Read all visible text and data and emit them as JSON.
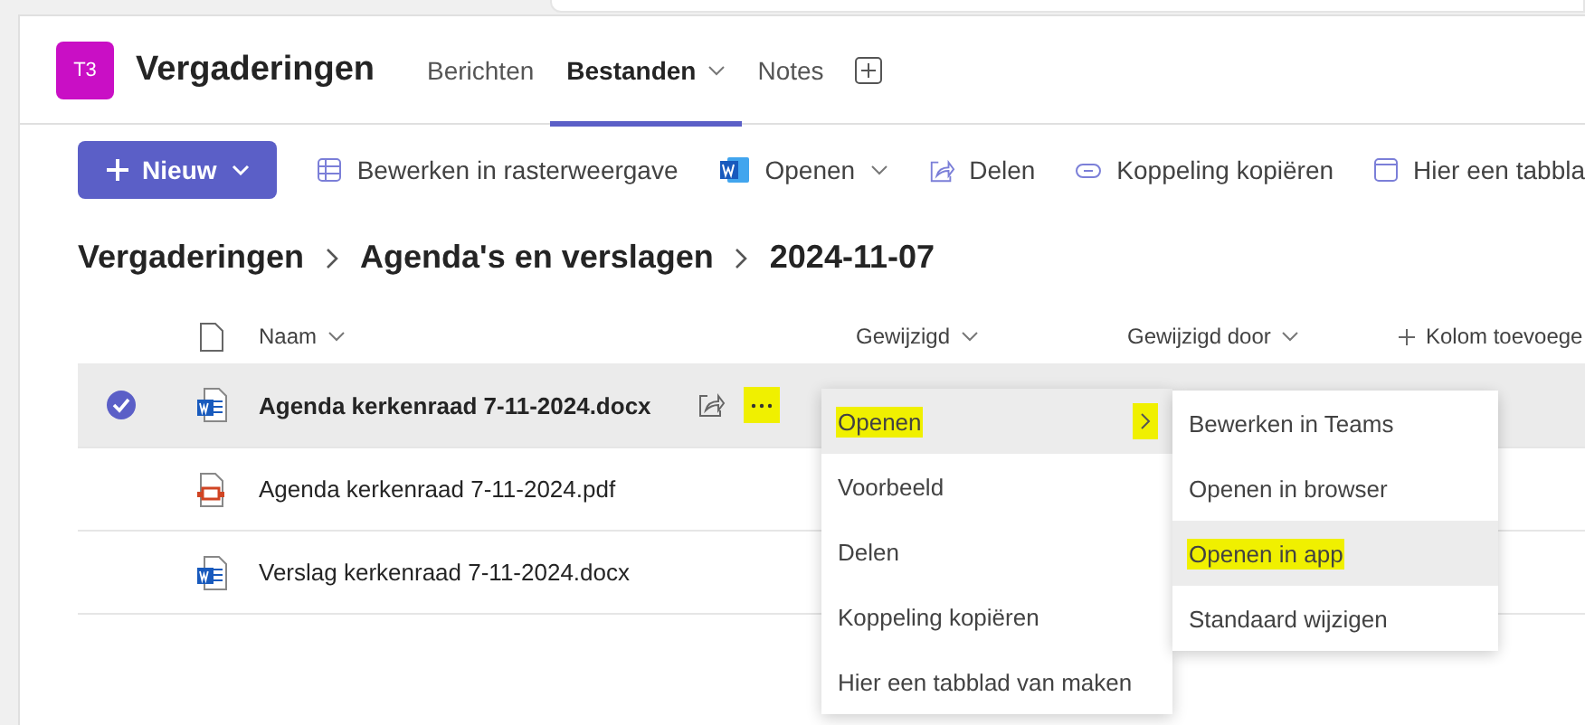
{
  "team": {
    "avatar": "T3",
    "name": "Vergaderingen"
  },
  "tabs": [
    {
      "label": "Berichten",
      "selected": false,
      "dropdown": false
    },
    {
      "label": "Bestanden",
      "selected": true,
      "dropdown": true
    },
    {
      "label": "Notes",
      "selected": false,
      "dropdown": false
    }
  ],
  "toolbar": {
    "new_button": "Nieuw",
    "actions": [
      {
        "kind": "grid",
        "label": "Bewerken in rasterweergave"
      },
      {
        "kind": "word",
        "label": "Openen",
        "dropdown": true
      },
      {
        "kind": "share",
        "label": "Delen"
      },
      {
        "kind": "link",
        "label": "Koppeling kopiëren"
      },
      {
        "kind": "tab",
        "label": "Hier een tabbla"
      }
    ]
  },
  "breadcrumb": [
    "Vergaderingen",
    "Agenda's en verslagen",
    "2024-11-07"
  ],
  "table": {
    "columns": [
      {
        "label": "Naam",
        "sortable": true
      },
      {
        "label": "Gewijzigd",
        "sortable": true
      },
      {
        "label": "Gewijzigd door",
        "sortable": true
      }
    ],
    "add_column": "Kolom toevoege",
    "rows": [
      {
        "name": "Agenda kerkenraad 7-11-2024.docx",
        "kind": "word",
        "selected": true,
        "more_highlighted": true
      },
      {
        "name": "Agenda kerkenraad 7-11-2024.pdf",
        "kind": "pdf",
        "selected": false,
        "more_highlighted": false
      },
      {
        "name": "Verslag kerkenraad 7-11-2024.docx",
        "kind": "word",
        "selected": false,
        "more_highlighted": false
      }
    ]
  },
  "context_menu": {
    "items": [
      {
        "label": "Openen",
        "hovered": true,
        "highlighted": true,
        "submenu": true
      },
      {
        "label": "Voorbeeld",
        "hovered": false,
        "highlighted": false,
        "submenu": false
      },
      {
        "label": "Delen",
        "hovered": false,
        "highlighted": false,
        "submenu": false
      },
      {
        "label": "Koppeling kopiëren",
        "hovered": false,
        "highlighted": false,
        "submenu": false
      },
      {
        "label": "Hier een tabblad van maken",
        "hovered": false,
        "highlighted": false,
        "submenu": false
      }
    ]
  },
  "submenu": {
    "items": [
      {
        "label": "Bewerken in Teams",
        "hovered": false,
        "highlighted": false
      },
      {
        "label": "Openen in browser",
        "hovered": false,
        "highlighted": false
      },
      {
        "label": "Openen in app",
        "hovered": true,
        "highlighted": true
      },
      {
        "label": "Standaard wijzigen",
        "hovered": false,
        "highlighted": false
      }
    ]
  }
}
